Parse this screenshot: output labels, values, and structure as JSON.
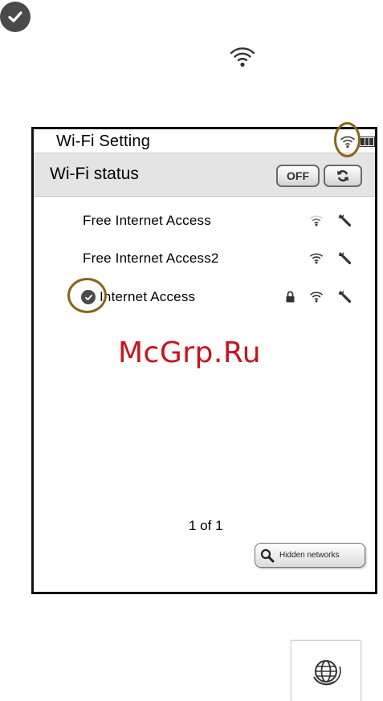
{
  "legend": {
    "check_icon": "check-circle-icon",
    "wifi_icon": "wifi-signal-icon"
  },
  "screen": {
    "title": "Wi-Fi Setting",
    "status_icons": [
      "wifi-signal-icon",
      "battery-icon"
    ],
    "status_label": "Wi-Fi status",
    "off_button_label": "OFF",
    "refresh_icon": "refresh-icon",
    "networks": [
      {
        "name": "Free Internet Access",
        "signal": "weak",
        "locked": false,
        "connected": false
      },
      {
        "name": "Free Internet Access2",
        "signal": "strong",
        "locked": false,
        "connected": false
      },
      {
        "name": "Internet Access",
        "signal": "strong",
        "locked": true,
        "connected": true
      }
    ],
    "watermark": "McGrp.Ru",
    "page_indicator": "1 of 1",
    "hidden_networks_label": "Hidden networks"
  },
  "bottom": {
    "globe_icon": "globe-icon"
  },
  "colors": {
    "highlight_ring": "#8a6416",
    "watermark": "#c8141e",
    "status_bar_bg": "#e4e4e4",
    "device_frame": "#111111"
  }
}
